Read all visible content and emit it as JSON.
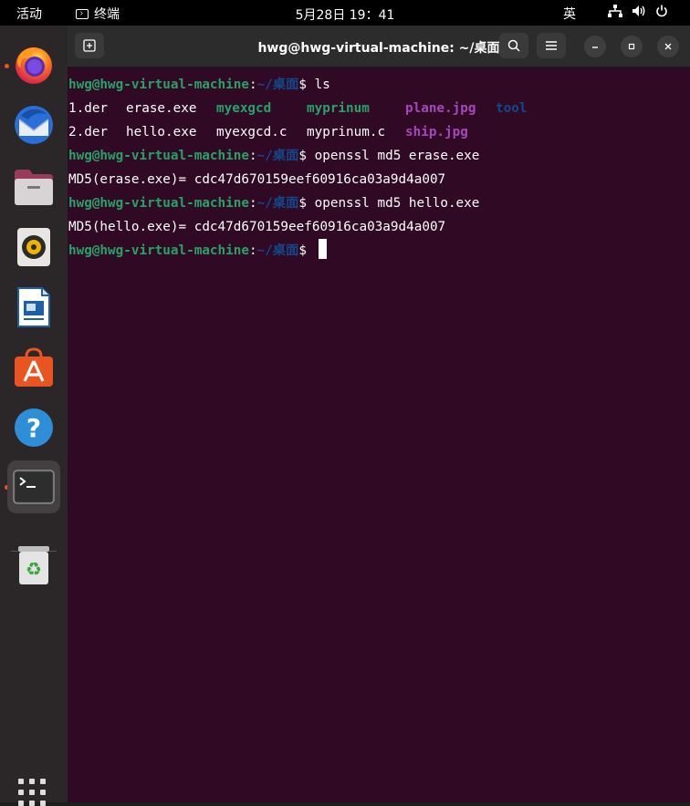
{
  "topbar": {
    "activities": "活动",
    "app_name": "终端",
    "clock": "5月28日  19：41",
    "ime": "英"
  },
  "window": {
    "title": "hwg@hwg-virtual-machine: ~/桌面"
  },
  "terminal": {
    "prompt_user": "hwg@hwg-virtual-machine",
    "prompt_sep": ":",
    "prompt_path": "~/桌面",
    "prompt_sign": "$ ",
    "commands": [
      "ls",
      "openssl md5 erase.exe",
      "openssl md5 hello.exe"
    ],
    "ls_row1": [
      "1.der",
      "erase.exe",
      "myexgcd",
      "myprinum",
      "plane.jpg",
      "tool"
    ],
    "ls_row2": [
      "2.der",
      "hello.exe",
      "myexgcd.c",
      "myprinum.c",
      "ship.jpg"
    ],
    "output1": "MD5(erase.exe)= cdc47d670159eef60916ca03a9d4a007",
    "output2": "MD5(hello.exe)= cdc47d670159eef60916ca03a9d4a007"
  },
  "dock": {
    "items": [
      "firefox-icon",
      "thunderbird-icon",
      "files-icon",
      "rhythmbox-icon",
      "writer-icon",
      "software-icon",
      "help-icon",
      "terminal-icon",
      "trash-icon"
    ]
  },
  "colors": {
    "terminal_bg": "#300a24",
    "prompt_user": "#26a269",
    "prompt_path": "#12488b",
    "image_file": "#a347ba",
    "accent": "#e95420"
  }
}
